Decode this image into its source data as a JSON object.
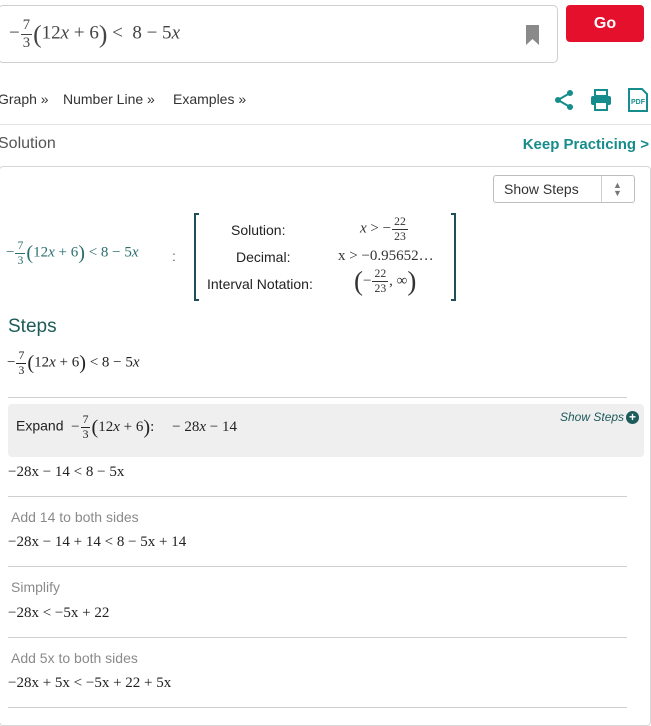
{
  "search": {
    "expression": "−7/3(12x+6) < 8 − 5x",
    "go_label": "Go"
  },
  "nav": {
    "items": [
      "Graph »",
      "Number Line »",
      "Examples »"
    ]
  },
  "icons": {
    "share": "share-icon",
    "print": "print-icon",
    "pdf": "pdf-icon",
    "bookmark": "bookmark-icon"
  },
  "header": {
    "title": "Solution",
    "keep_practicing": "Keep Practicing >"
  },
  "dropdown": {
    "selected": "Show Steps"
  },
  "result": {
    "expression": "−7/3(12x+6) < 8 − 5x",
    "colon": ":",
    "solution_label": "Solution:",
    "solution_value": "x > −22/23",
    "decimal_label": "Decimal:",
    "decimal_value": "x > −0.95652…",
    "interval_label": "Interval Notation:",
    "interval_value": "(−22/23, ∞)"
  },
  "steps": {
    "title": "Steps",
    "start": "−7/3(12x+6) < 8 − 5x",
    "expand_prefix": "Expand",
    "expand_expr": "−7/3(12x+6):",
    "expand_result": "− 28x − 14",
    "expand_show": "Show Steps",
    "items": [
      {
        "label": "",
        "expr": "−28x − 14 < 8 − 5x"
      },
      {
        "label": "Add 14 to both sides",
        "expr": "−28x − 14 + 14 < 8 − 5x + 14"
      },
      {
        "label": "Simplify",
        "expr": "−28x < −5x + 22"
      },
      {
        "label": "Add 5x to both sides",
        "expr": "−28x + 5x < −5x + 22 + 5x"
      }
    ]
  },
  "colors": {
    "accent": "#e5102c",
    "teal": "#178c8c",
    "dark_teal": "#1e5b5b"
  }
}
